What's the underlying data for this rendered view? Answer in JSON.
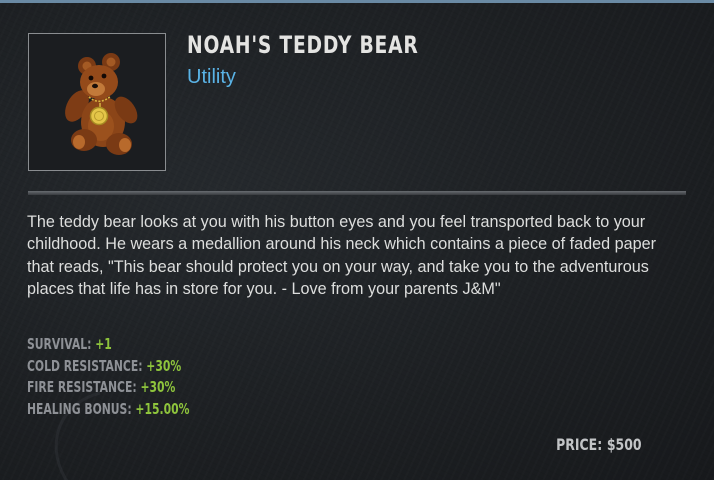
{
  "item": {
    "name": "NOAH'S TEDDY BEAR",
    "type": "Utility",
    "icon": "teddy-bear-with-gold-medallion",
    "description": "The teddy bear looks at you with his button eyes and you feel transported back to your childhood. He wears a medallion around his neck which contains a piece of faded paper that reads, \"This bear should protect you on your way, and take you to the adventurous places that life has in store for you. - Love from your parents J&M\""
  },
  "stats": [
    {
      "label": "SURVIVAL:",
      "value": "+1"
    },
    {
      "label": "COLD RESISTANCE:",
      "value": "+30%"
    },
    {
      "label": "FIRE RESISTANCE:",
      "value": "+30%"
    },
    {
      "label": "HEALING BONUS:",
      "value": "+15.00%"
    }
  ],
  "price": {
    "label": "PRICE:",
    "value": "$500"
  },
  "colors": {
    "title": "#e4e4e2",
    "type": "#5ab3e6",
    "stat_label": "#8e9196",
    "stat_value": "#8ec43c",
    "border_top": "#6a8aa4"
  }
}
